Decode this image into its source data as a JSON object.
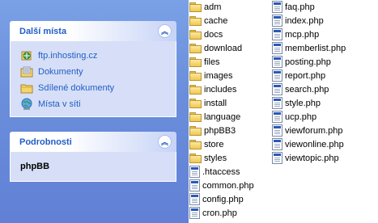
{
  "task_pane": {
    "other_places": {
      "title": "Další místa",
      "items": [
        {
          "label": "ftp.inhosting.cz",
          "icon": "ftp-site-icon"
        },
        {
          "label": "Dokumenty",
          "icon": "documents-folder-icon"
        },
        {
          "label": "Sdílené dokumenty",
          "icon": "shared-folder-icon"
        },
        {
          "label": "Místa v síti",
          "icon": "network-places-icon"
        }
      ]
    },
    "details": {
      "title": "Podrobnosti",
      "name": "phpBB"
    },
    "collapse_glyph": "︽"
  },
  "files": {
    "column1": [
      {
        "label": "adm",
        "type": "folder"
      },
      {
        "label": "cache",
        "type": "folder"
      },
      {
        "label": "docs",
        "type": "folder"
      },
      {
        "label": "download",
        "type": "folder"
      },
      {
        "label": "files",
        "type": "folder"
      },
      {
        "label": "images",
        "type": "folder"
      },
      {
        "label": "includes",
        "type": "folder"
      },
      {
        "label": "install",
        "type": "folder"
      },
      {
        "label": "language",
        "type": "folder"
      },
      {
        "label": "phpBB3",
        "type": "folder"
      },
      {
        "label": "store",
        "type": "folder"
      },
      {
        "label": "styles",
        "type": "folder"
      },
      {
        "label": ".htaccess",
        "type": "file"
      },
      {
        "label": "common.php",
        "type": "file"
      },
      {
        "label": "config.php",
        "type": "file"
      },
      {
        "label": "cron.php",
        "type": "file"
      }
    ],
    "column2": [
      {
        "label": "faq.php",
        "type": "file"
      },
      {
        "label": "index.php",
        "type": "file"
      },
      {
        "label": "mcp.php",
        "type": "file"
      },
      {
        "label": "memberlist.php",
        "type": "file"
      },
      {
        "label": "posting.php",
        "type": "file"
      },
      {
        "label": "report.php",
        "type": "file"
      },
      {
        "label": "search.php",
        "type": "file"
      },
      {
        "label": "style.php",
        "type": "file"
      },
      {
        "label": "ucp.php",
        "type": "file"
      },
      {
        "label": "viewforum.php",
        "type": "file"
      },
      {
        "label": "viewonline.php",
        "type": "file"
      },
      {
        "label": "viewtopic.php",
        "type": "file"
      }
    ]
  }
}
